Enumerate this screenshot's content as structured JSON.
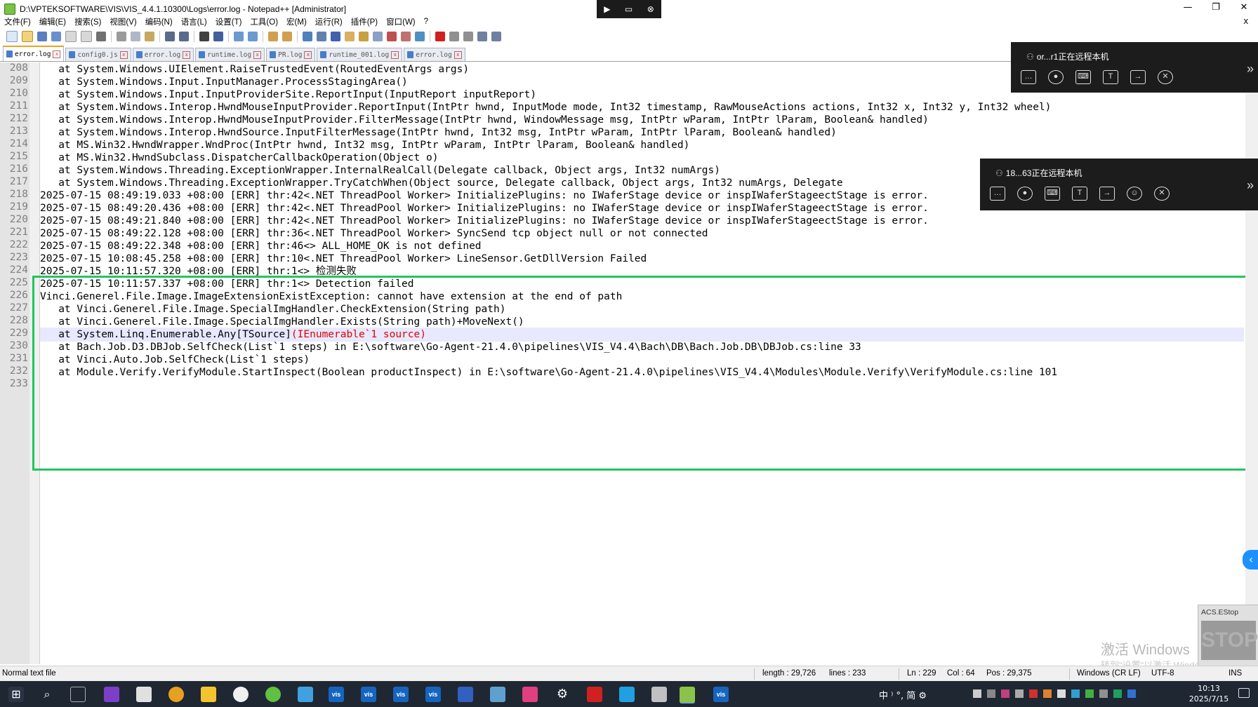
{
  "window": {
    "title": "D:\\VPTEKSOFTWARE\\VIS\\VIS_4.4.1.10300\\Logs\\error.log - Notepad++ [Administrator]",
    "minimize": "—",
    "maximize": "❐",
    "close": "✕"
  },
  "menu": {
    "items": [
      "文件(F)",
      "编辑(E)",
      "搜索(S)",
      "视图(V)",
      "编码(N)",
      "语言(L)",
      "设置(T)",
      "工具(O)",
      "宏(M)",
      "运行(R)",
      "插件(P)",
      "窗口(W)",
      "?"
    ],
    "close": "x"
  },
  "tabs": [
    {
      "label": "error.log",
      "active": true
    },
    {
      "label": "config0.js",
      "active": false
    },
    {
      "label": "error.log",
      "active": false
    },
    {
      "label": "runtime.log",
      "active": false
    },
    {
      "label": "PR.log",
      "active": false
    },
    {
      "label": "runtime_001.log",
      "active": false
    },
    {
      "label": "error.log",
      "active": false
    }
  ],
  "editor": {
    "lines": [
      {
        "n": "208",
        "text": "   at System.Windows.UIElement.RaiseTrustedEvent(RoutedEventArgs args)"
      },
      {
        "n": "209",
        "text": "   at System.Windows.Input.InputManager.ProcessStagingArea()"
      },
      {
        "n": "210",
        "text": "   at System.Windows.Input.InputProviderSite.ReportInput(InputReport inputReport)"
      },
      {
        "n": "211",
        "text": "   at System.Windows.Interop.HwndMouseInputProvider.ReportInput(IntPtr hwnd, InputMode mode, Int32 timestamp, RawMouseActions actions, Int32 x, Int32 y, Int32 wheel)"
      },
      {
        "n": "212",
        "text": "   at System.Windows.Interop.HwndMouseInputProvider.FilterMessage(IntPtr hwnd, WindowMessage msg, IntPtr wParam, IntPtr lParam, Boolean& handled)"
      },
      {
        "n": "213",
        "text": "   at System.Windows.Interop.HwndSource.InputFilterMessage(IntPtr hwnd, Int32 msg, IntPtr wParam, IntPtr lParam, Boolean& handled)"
      },
      {
        "n": "214",
        "text": "   at MS.Win32.HwndWrapper.WndProc(IntPtr hwnd, Int32 msg, IntPtr wParam, IntPtr lParam, Boolean& handled)"
      },
      {
        "n": "215",
        "text": "   at MS.Win32.HwndSubclass.DispatcherCallbackOperation(Object o)"
      },
      {
        "n": "216",
        "text": "   at System.Windows.Threading.ExceptionWrapper.InternalRealCall(Delegate callback, Object args, Int32 numArgs)"
      },
      {
        "n": "217",
        "text": "   at System.Windows.Threading.ExceptionWrapper.TryCatchWhen(Object source, Delegate callback, Object args, Int32 numArgs, Delegate"
      },
      {
        "n": "218",
        "text": "2025-07-15 08:49:19.033 +08:00 [ERR] thr:42<.NET ThreadPool Worker> InitializePlugins: no IWaferStage device or inspIWaferStageectStage is error."
      },
      {
        "n": "219",
        "text": "2025-07-15 08:49:20.436 +08:00 [ERR] thr:42<.NET ThreadPool Worker> InitializePlugins: no IWaferStage device or inspIWaferStageectStage is error."
      },
      {
        "n": "220",
        "text": "2025-07-15 08:49:21.840 +08:00 [ERR] thr:42<.NET ThreadPool Worker> InitializePlugins: no IWaferStage device or inspIWaferStageectStage is error."
      },
      {
        "n": "221",
        "text": "2025-07-15 08:49:22.128 +08:00 [ERR] thr:36<.NET ThreadPool Worker> SyncSend tcp object null or not connected"
      },
      {
        "n": "222",
        "text": "2025-07-15 08:49:22.348 +08:00 [ERR] thr:46<> ALL_HOME_OK is not defined"
      },
      {
        "n": "223",
        "text": "2025-07-15 10:08:45.258 +08:00 [ERR] thr:10<.NET ThreadPool Worker> LineSensor.GetDllVersion Failed"
      },
      {
        "n": "224",
        "text": "2025-07-15 10:11:57.320 +08:00 [ERR] thr:1<> 检测失败"
      },
      {
        "n": "225",
        "text": "2025-07-15 10:11:57.337 +08:00 [ERR] thr:1<> Detection failed"
      },
      {
        "n": "226",
        "text": "Vinci.Generel.File.Image.ImageExtensionExistException: cannot have extension at the end of path"
      },
      {
        "n": "227",
        "text": "   at Vinci.Generel.File.Image.SpecialImgHandler.CheckExtension(String path)"
      },
      {
        "n": "228",
        "text": "   at Vinci.Generel.File.Image.SpecialImgHandler.Exists(String path)+MoveNext()"
      },
      {
        "n": "229",
        "text_pre": "   at System.Linq.Enumerable.Any[TSource]",
        "text_brace": "(IEnumerable`1 source)"
      },
      {
        "n": "230",
        "text": "   at Bach.Job.D3.DBJob.SelfCheck(List`1 steps) in E:\\software\\Go-Agent-21.4.0\\pipelines\\VIS_V4.4\\Bach\\DB\\Bach.Job.DB\\DBJob.cs:line 33"
      },
      {
        "n": "231",
        "text": "   at Vinci.Auto.Job.SelfCheck(List`1 steps)"
      },
      {
        "n": "232",
        "text": "   at Module.Verify.VerifyModule.StartInspect(Boolean productInspect) in E:\\software\\Go-Agent-21.4.0\\pipelines\\VIS_V4.4\\Modules\\Module.Verify\\VerifyModule.cs:line 101"
      },
      {
        "n": "233",
        "text": ""
      }
    ]
  },
  "remote_panels": [
    {
      "title": "or...r1正在远程本机",
      "expand": "»"
    },
    {
      "title": "18...63正在远程本机",
      "expand": "»"
    }
  ],
  "acs": {
    "label": "ACS.EStop",
    "stop": "STOP"
  },
  "watermark": {
    "line1": "激活 Windows",
    "line2": "转到\"设置\"以激活 Windows。"
  },
  "status": {
    "file_type": "Normal text file",
    "length": "length : 29,726",
    "lines": "lines : 233",
    "ln": "Ln : 229",
    "col": "Col : 64",
    "pos": "Pos : 29,375",
    "eol": "Windows (CR LF)",
    "encoding": "UTF-8",
    "mode": "INS"
  },
  "taskbar": {
    "vis_label": "vis",
    "clock_time": "10:13",
    "clock_date": "2025/7/15",
    "tray_text": "中 ⁾ °, 简 ⚙"
  },
  "colors": {
    "highlight_box": "#22c55e",
    "brace": "#e00000",
    "current_line": "#e8e8ff"
  }
}
